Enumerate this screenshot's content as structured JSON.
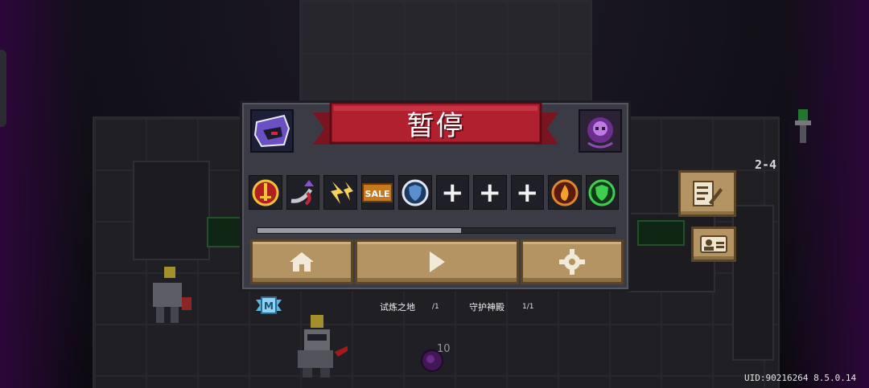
{
  "hud": {
    "level": "2-4",
    "uid": "UID:90216264 8.5.0.14"
  },
  "pause_menu": {
    "title": "暂停",
    "character_icon": "assassin-helmet-icon",
    "emblem_icon": "purple-skull-emblem-icon",
    "buffs": [
      {
        "name": "sword-buff-icon",
        "empty": false
      },
      {
        "name": "scythe-buff-icon",
        "empty": false
      },
      {
        "name": "lightning-burst-buff-icon",
        "empty": false
      },
      {
        "name": "sale-buff-icon",
        "label": "SALE",
        "empty": false
      },
      {
        "name": "shield-buff-icon",
        "empty": false
      },
      {
        "name": "empty-slot-1",
        "label": "+",
        "empty": true
      },
      {
        "name": "empty-slot-2",
        "label": "+",
        "empty": true
      },
      {
        "name": "empty-slot-3",
        "label": "+",
        "empty": true
      },
      {
        "name": "fire-shield-buff-icon",
        "empty": false
      },
      {
        "name": "green-shield-buff-icon",
        "empty": false
      }
    ],
    "progress": 0.57,
    "buttons": {
      "home": "home-icon",
      "resume": "play-icon",
      "settings": "gear-icon"
    }
  },
  "stage_info": {
    "badge": "M",
    "stages": [
      {
        "name": "试炼之地",
        "count": "/1"
      },
      {
        "name": "守护神殿",
        "count": "1/1"
      }
    ]
  },
  "world": {
    "bomb_count": "10"
  },
  "colors": {
    "ribbon": "#b0202e",
    "button": "#b39462",
    "panel": "#3b3b45"
  }
}
